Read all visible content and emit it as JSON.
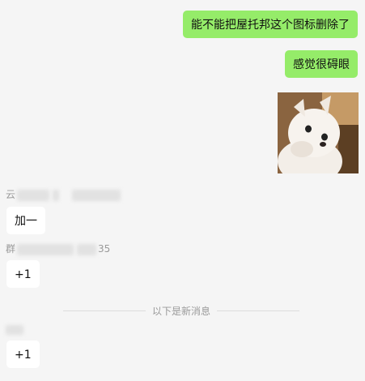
{
  "messages": {
    "out1": "能不能把屋托邦这个图标删除了",
    "out2": "感觉很碍眼",
    "in1": "加一",
    "in2": "+1",
    "in3": "+1"
  },
  "senders": {
    "s1_prefix": "云",
    "s2_prefix": "群",
    "s2_suffix": "35"
  },
  "divider": {
    "label": "以下是新消息"
  },
  "colors": {
    "outgoing_bubble": "#95ec69",
    "incoming_bubble": "#ffffff",
    "background": "#f5f5f5"
  },
  "photo": {
    "subject": "white-pomeranian-dog-photo"
  }
}
